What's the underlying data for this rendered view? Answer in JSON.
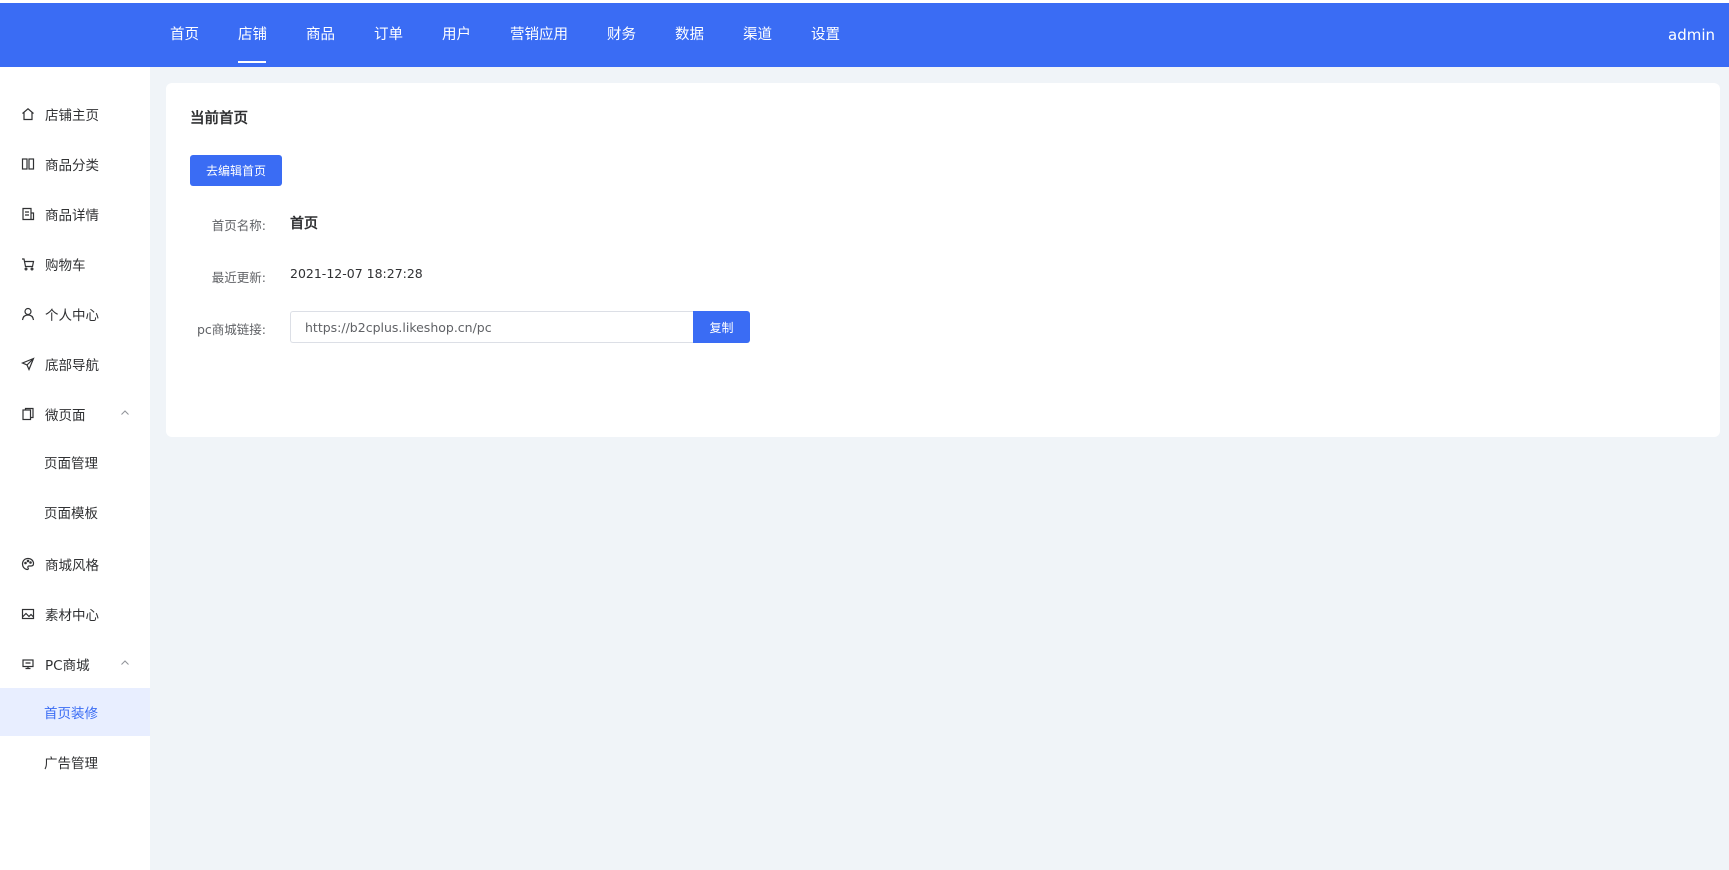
{
  "topnav": {
    "items": [
      "首页",
      "店铺",
      "商品",
      "订单",
      "用户",
      "营销应用",
      "财务",
      "数据",
      "渠道",
      "设置"
    ],
    "active_index": 1,
    "user": "admin"
  },
  "sidebar": {
    "items": [
      {
        "label": "店铺主页",
        "icon": "home-icon"
      },
      {
        "label": "商品分类",
        "icon": "category-icon"
      },
      {
        "label": "商品详情",
        "icon": "detail-icon"
      },
      {
        "label": "购物车",
        "icon": "cart-icon"
      },
      {
        "label": "个人中心",
        "icon": "user-icon"
      },
      {
        "label": "底部导航",
        "icon": "send-icon"
      },
      {
        "label": "微页面",
        "icon": "pages-icon",
        "expanded": true
      },
      {
        "label": "页面管理",
        "sub": true
      },
      {
        "label": "页面模板",
        "sub": true
      },
      {
        "label": "商城风格",
        "icon": "palette-icon"
      },
      {
        "label": "素材中心",
        "icon": "image-icon"
      },
      {
        "label": "PC商城",
        "icon": "monitor-icon",
        "expanded": true
      },
      {
        "label": "首页装修",
        "sub": true,
        "active": true
      },
      {
        "label": "广告管理",
        "sub": true
      }
    ]
  },
  "main": {
    "title": "当前首页",
    "edit_button": "去编辑首页",
    "name_label": "首页名称:",
    "name_value": "首页",
    "updated_label": "最近更新:",
    "updated_value": "2021-12-07 18:27:28",
    "link_label": "pc商城链接:",
    "link_value": "https://b2cplus.likeshop.cn/pc",
    "copy_button": "复制"
  },
  "colors": {
    "primary": "#3a6cf4",
    "background": "#f0f4f8",
    "active_bg": "#e8eeff"
  }
}
